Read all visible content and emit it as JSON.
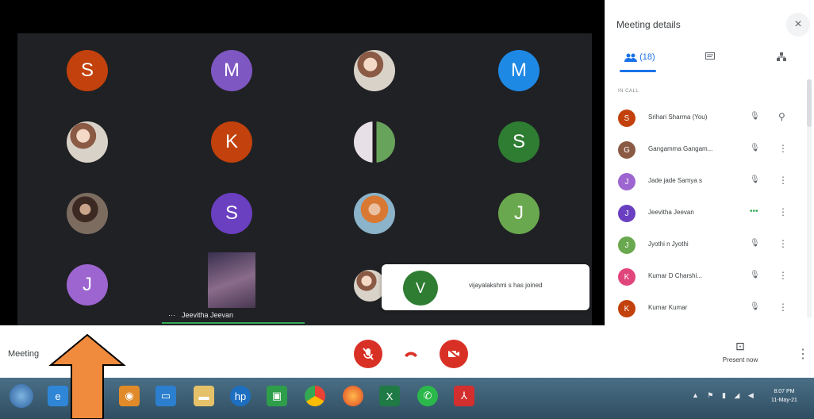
{
  "grid": [
    {
      "initial": "S",
      "color": "#c2410c",
      "photo": ""
    },
    {
      "initial": "M",
      "color": "#7e57c2",
      "photo": ""
    },
    {
      "initial": "",
      "color": "",
      "photo": "photo"
    },
    {
      "initial": "M",
      "color": "#1e88e5",
      "photo": ""
    },
    {
      "initial": "",
      "color": "",
      "photo": "photo"
    },
    {
      "initial": "K",
      "color": "#c2410c",
      "photo": ""
    },
    {
      "initial": "",
      "color": "",
      "photo": "photo mixed"
    },
    {
      "initial": "S",
      "color": "#2e7d32",
      "photo": ""
    },
    {
      "initial": "",
      "color": "",
      "photo": "photo dark"
    },
    {
      "initial": "S",
      "color": "#6a3fc0",
      "photo": ""
    },
    {
      "initial": "",
      "color": "",
      "photo": "photo orange"
    },
    {
      "initial": "J",
      "color": "#6aa84f",
      "photo": ""
    },
    {
      "initial": "J",
      "color": "#9c65cf",
      "photo": ""
    }
  ],
  "video_tile": {
    "name": "Jeevitha Jeevan",
    "mic_glyph": "···"
  },
  "toast": {
    "initial": "V",
    "message": "vijayalakshmi s has joined"
  },
  "panel": {
    "title": "Meeting details",
    "close": "×",
    "tabs": [
      {
        "label": "(18)",
        "icon": "people-icon"
      },
      {
        "label": "",
        "icon": "chat-icon"
      },
      {
        "label": "",
        "icon": "activities-icon"
      }
    ],
    "section_label": "IN CALL",
    "people": [
      {
        "name": "Srihari Sharma (You)",
        "initial": "S",
        "color": "#c2410c",
        "more": "⋮"
      },
      {
        "name": "Gangamma Gangam...",
        "initial": "G",
        "color": "#8a5a44",
        "more": "⋮"
      },
      {
        "name": "Jade jade Samya s",
        "initial": "J",
        "color": "#9c65cf",
        "more": "⋮"
      },
      {
        "name": "Jeevitha Jeevan",
        "initial": "J",
        "color": "#6a3fc0",
        "more": "⋮"
      },
      {
        "name": "Jyothi n Jyothi",
        "initial": "J",
        "color": "#6aa84f",
        "more": "⋮"
      },
      {
        "name": "Kumar D Charshi...",
        "initial": "K",
        "color": "#e0457b",
        "more": "⋮"
      },
      {
        "name": "Kumar Kumar",
        "initial": "K",
        "color": "#c2410c",
        "more": "⋮"
      }
    ]
  },
  "bottom": {
    "meeting_label": "Meeting",
    "present_label": "Present now",
    "present_icon": "⊡",
    "more": "⋮"
  },
  "taskbar": {
    "clock_time": "8:07 PM",
    "clock_date": "11-May-21"
  },
  "accent": {
    "red": "#d93025",
    "blue": "#1a73e8",
    "arrow": "#f08a3c"
  }
}
